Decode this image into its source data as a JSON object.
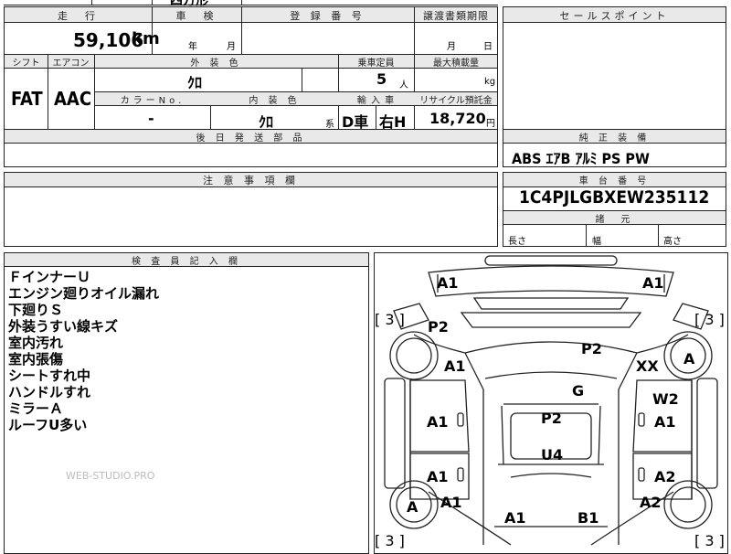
{
  "top_partial": {
    "text": "四方形"
  },
  "mileage": {
    "header": "走　行",
    "value": "59,106",
    "unit": "km"
  },
  "shaken": {
    "header": "車　検",
    "year_label": "年",
    "month_label": "月"
  },
  "registration": {
    "header": "登 録 番 号"
  },
  "transfer": {
    "header": "譲渡書類期限",
    "month_label": "月",
    "day_label": "日"
  },
  "shift": {
    "header": "シフト",
    "value": "FAT"
  },
  "aircon": {
    "header": "エアコン",
    "value": "AAC"
  },
  "exterior_color": {
    "header": "外 装 色",
    "value": "ｸﾛ"
  },
  "capacity": {
    "header": "乗車定員",
    "value": "5",
    "unit": "人"
  },
  "max_load": {
    "header": "最大積載量",
    "unit": "kg"
  },
  "color_no": {
    "header": "カラーNo.",
    "value": "-"
  },
  "interior_color": {
    "header": "内 装 色",
    "value": "ｸﾛ",
    "suffix": "系"
  },
  "import": {
    "header": "輸 入 車",
    "value1": "D車",
    "value2": "右H"
  },
  "recycle": {
    "header": "リサイクル預託金",
    "value": "18,720",
    "unit": "円"
  },
  "later_parts": {
    "header": "後 日 発 送 部 品"
  },
  "sales_points": {
    "header": "セールスポイント"
  },
  "equipment": {
    "header": "純 正 装 備",
    "value": "ABS ｴｱB ｱﾙﾐ PS PW"
  },
  "caution": {
    "header": "注 意 事 項 欄"
  },
  "chassis": {
    "header": "車 台 番 号",
    "value": "1C4PJLGBXEW235112"
  },
  "dimensions": {
    "header": "諸　元",
    "length_label": "長さ",
    "width_label": "幅",
    "height_label": "高さ"
  },
  "inspector": {
    "header": "検 査 員 記 入 欄",
    "notes": [
      "ＦインナーＵ",
      "エンジン廻りオイル漏れ",
      "下廻りＳ",
      "外装うすい線キズ",
      "室内汚れ",
      "室内張傷",
      "シートすれ中",
      "ハンドルすれ",
      "ミラーＡ",
      "ルーフU多い"
    ]
  },
  "watermark": "WEB-STUDIO.PRO",
  "diagram": {
    "tires": [
      "[ 3 ]",
      "[ 3 ]",
      "[ 3 ]",
      "[ 3 ]"
    ],
    "marks": {
      "fl_corner": "A1",
      "fr_corner": "A1",
      "p2_left": "P2",
      "p2_right": "P2",
      "a1_left_front": "A1",
      "xx": "XX",
      "tire_right_front": "A",
      "g": "G",
      "w2": "W2",
      "a1_left_door": "A1",
      "p2_roof": "P2",
      "a1_right_door": "A1",
      "u4": "U4",
      "a1_left_rear": "A1",
      "a2_right_rear": "A2",
      "tire_left_rear": "A",
      "a1_left_qtr": "A1",
      "a2_right_qtr": "A2",
      "a1_rear": "A1",
      "b1_rear": "B1"
    }
  }
}
